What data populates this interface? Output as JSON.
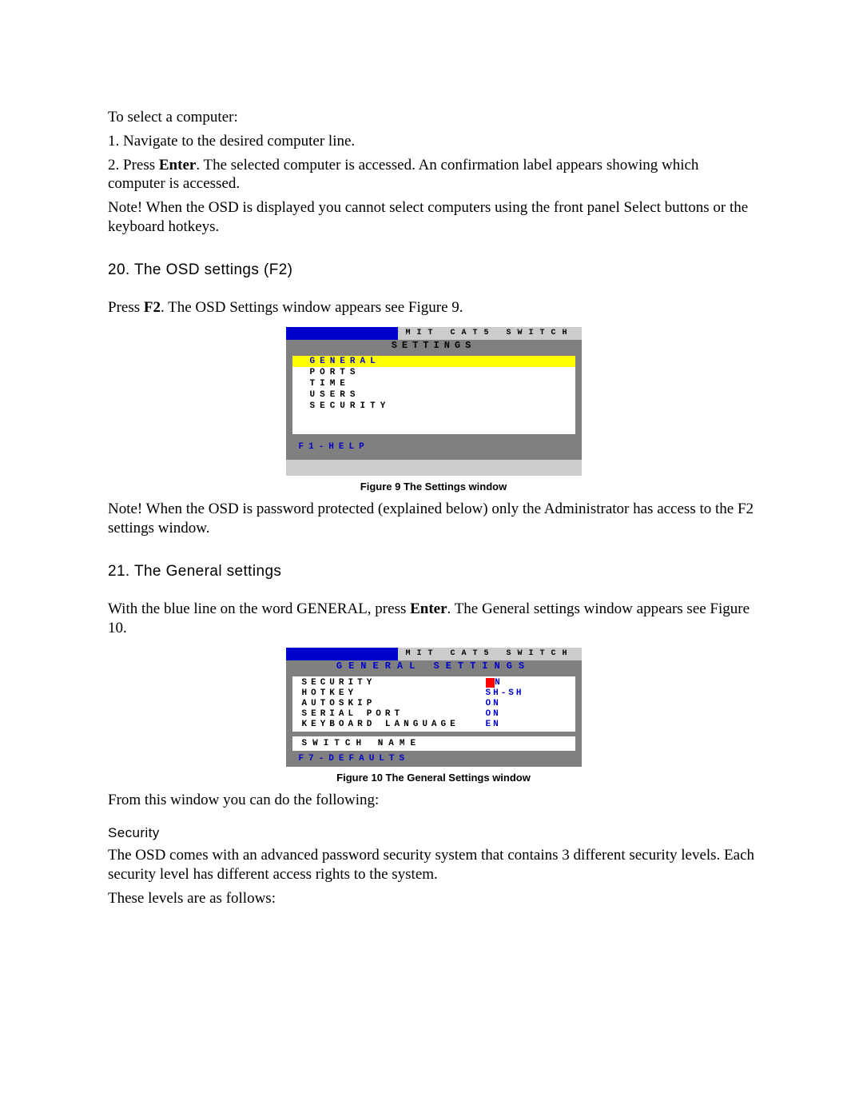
{
  "intro": {
    "line1": "To select a computer:",
    "step1": "1. Navigate to the desired computer line.",
    "step2_pre": "2. Press ",
    "step2_bold": "Enter",
    "step2_post": ". The selected computer is accessed. An confirmation label appears showing which computer is accessed.",
    "note": "Note! When the OSD is displayed you cannot select computers using the front panel Select buttons or the keyboard hotkeys."
  },
  "section20": {
    "heading": "20. The OSD settings (F2)",
    "paragraph_pre": "Press ",
    "paragraph_bold": "F2",
    "paragraph_post": ". The OSD Settings window appears see Figure 9.",
    "osd": {
      "title": "MIT CAT5 SWITCH",
      "subtitle": "SETTINGS",
      "items": [
        "GENERAL",
        "PORTS",
        "TIME",
        "USERS",
        "SECURITY"
      ],
      "help": "F1-HELP"
    },
    "caption": "Figure 9 The Settings window",
    "note": "Note! When the OSD is password protected (explained below) only the Administrator has access to the F2 settings window."
  },
  "section21": {
    "heading": "21. The General settings",
    "paragraph_pre": "With the blue line on the word GENERAL, press ",
    "paragraph_bold": "Enter",
    "paragraph_post": ". The General settings window appears see Figure 10.",
    "osd": {
      "title": "MIT CAT5 SWITCH",
      "subtitle": "GENERAL SETTINGS",
      "rows": [
        {
          "label": "SECURITY",
          "value": "N",
          "selected": true,
          "prefix_red": "O"
        },
        {
          "label": "HOTKEY",
          "value": "SH-SH",
          "selected": false,
          "prefix_red": ""
        },
        {
          "label": "AUTOSKIP",
          "value": "ON",
          "selected": false,
          "prefix_red": ""
        },
        {
          "label": "SERIAL PORT",
          "value": "ON",
          "selected": false,
          "prefix_red": ""
        },
        {
          "label": "KEYBOARD LANGUAGE",
          "value": "EN",
          "selected": false,
          "prefix_red": ""
        }
      ],
      "switch_name": "SWITCH NAME",
      "defaults": "F7-DEFAULTS"
    },
    "caption": "Figure 10 The General Settings window",
    "after": "From this window you can do the following:",
    "security_heading": "Security",
    "security_body": "The OSD comes with an advanced password security system that contains 3 different security levels. Each security level has different access rights to the system.",
    "levels_intro": "These levels are as follows:"
  }
}
